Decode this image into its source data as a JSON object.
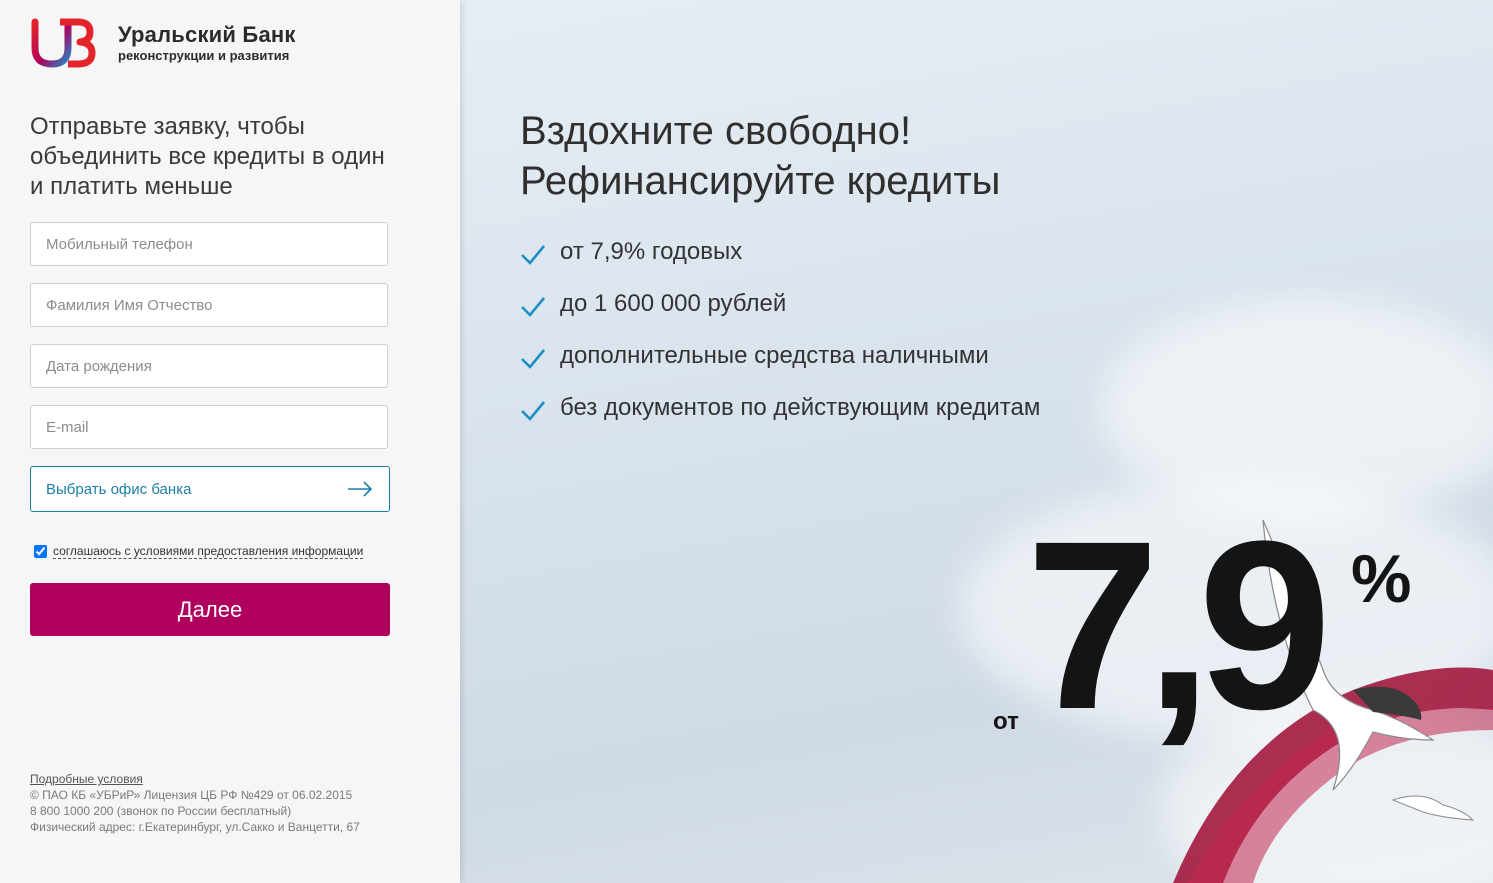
{
  "brand": {
    "name": "Уральский Банк",
    "subtitle": "реконструкции и развития",
    "colors": {
      "logo_red": "#e3242b",
      "logo_blue": "#1e88c7",
      "accent": "#b0005e",
      "link": "#1b7fa8"
    }
  },
  "form": {
    "title": "Отправьте заявку, чтобы объединить все кредиты в один и платить меньше",
    "phone_placeholder": "Мобильный телефон",
    "name_placeholder": "Фамилия Имя Отчество",
    "birth_placeholder": "Дата рождения",
    "email_placeholder": "E-mail",
    "office_label": "Выбрать офис банка",
    "agree_label": "соглашаюсь с условиями предоставления информации",
    "agree_checked": true,
    "submit_label": "Далее"
  },
  "footer": {
    "terms_link": "Подробные условия",
    "license": "© ПАО КБ «УБРиР» Лицензия ЦБ РФ №429 от 06.02.2015",
    "phone": "8 800 1000 200 (звонок по России бесплатный)",
    "address": "Физический адрес: г.Екатеринбург, ул.Сакко и Ванцетти, 67"
  },
  "hero": {
    "headline_line1": "Вздохните свободно!",
    "headline_line2": "Рефинансируйте кредиты",
    "benefits": [
      "от 7,9% годовых",
      "до 1 600 000 рублей",
      "дополнительные средства наличными",
      "без документов по действующим кредитам"
    ],
    "check_icon": "check-icon",
    "rate_prefix": "от",
    "rate_value": "7,9",
    "rate_unit": "%"
  }
}
